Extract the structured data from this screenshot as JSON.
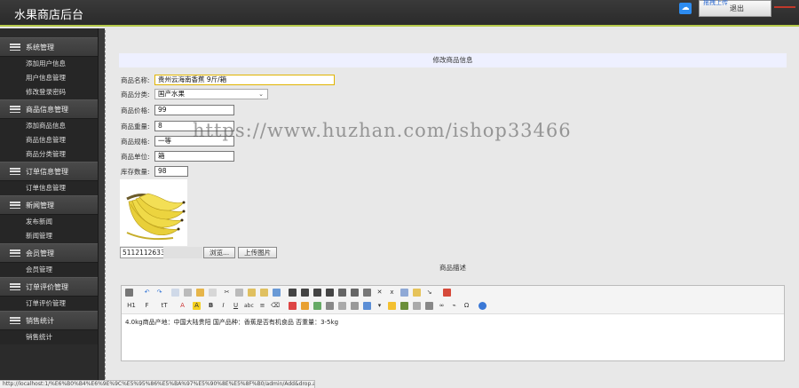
{
  "header": {
    "title": "水果商店后台",
    "upload_label": "拖拽上传",
    "button_label": "退出"
  },
  "sidebar": {
    "groups": [
      {
        "label": "系统管理",
        "items": [
          "添加用户信息",
          "用户信息管理",
          "修改登录密码"
        ]
      },
      {
        "label": "商品信息管理",
        "items": [
          "添加商品信息",
          "商品信息管理",
          "商品分类管理"
        ]
      },
      {
        "label": "订单信息管理",
        "items": [
          "订单信息管理"
        ]
      },
      {
        "label": "新闻管理",
        "items": [
          "发布新闻",
          "新闻管理"
        ]
      },
      {
        "label": "会员管理",
        "items": [
          "会员管理"
        ]
      },
      {
        "label": "订单评价管理",
        "items": [
          "订单评价管理"
        ]
      },
      {
        "label": "销售统计",
        "items": [
          "销售统计"
        ]
      }
    ]
  },
  "main": {
    "panel_title": "修改商品信息",
    "fields": {
      "name": {
        "label": "商品名称:",
        "value": "贵州云海南香蕉 9斤/箱"
      },
      "category": {
        "label": "商品分类:",
        "value": "国产水果"
      },
      "price": {
        "label": "商品价格:",
        "value": "99"
      },
      "quantity": {
        "label": "商品重量:",
        "value": "8"
      },
      "spec": {
        "label": "商品规格:",
        "value": "一等"
      },
      "unit": {
        "label": "商品单位:",
        "value": "箱"
      },
      "stock": {
        "label": "库存数量:",
        "value": "98"
      }
    },
    "file_value": "5112112633",
    "browse_label": "浏览...",
    "upload_label": "上传图片",
    "desc_label": "商品描述",
    "editor_content": "4.0kg商品产地：中国大陆贵阳  国产品种：香蕉是否有机食品  否重量：3-5kg",
    "watermark": "https://www.huzhan.com/ishop33466"
  },
  "statusbar": {
    "text": "http://localhost:1/%E6%B0%B4%E6%9E%9C%E5%95%86%E5%BA%97%E5%90%8E%E5%8F%B0/admin/Add&drop.aspx"
  }
}
